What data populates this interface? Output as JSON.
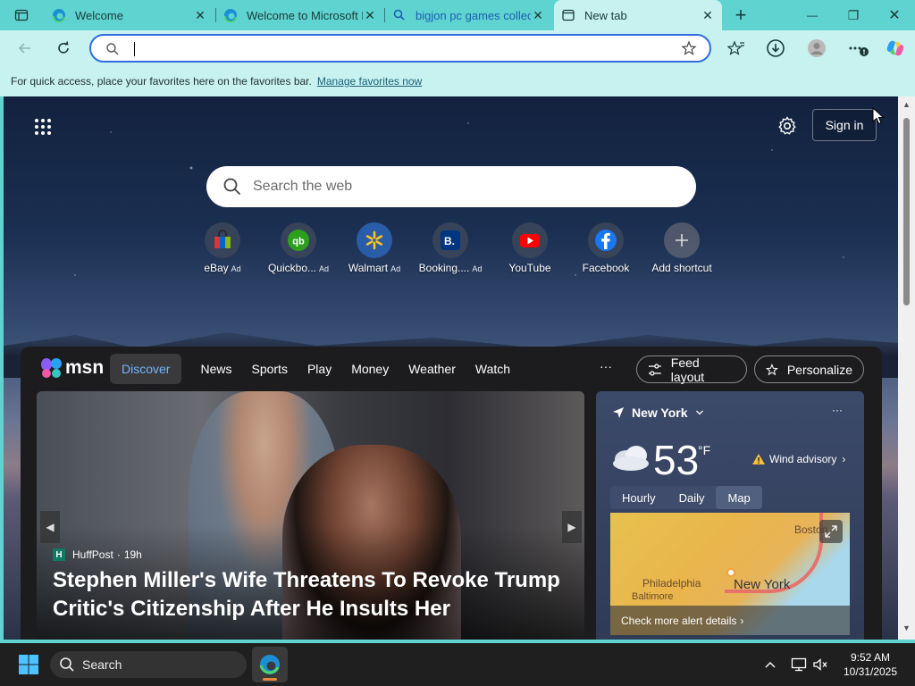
{
  "tabs": [
    {
      "title": "Welcome",
      "active": false
    },
    {
      "title": "Welcome to Microsoft E",
      "active": false
    },
    {
      "title": "bigjon pc games collect",
      "active": false
    },
    {
      "title": "New tab",
      "active": true
    }
  ],
  "tab_close": "✕",
  "new_tab_symbol": "+",
  "window_controls": {
    "minimize": "—",
    "restore": "❐",
    "close": "✕"
  },
  "address_bar": {
    "value": "",
    "placeholder": ""
  },
  "favorites_bar": {
    "message": "For quick access, place your favorites here on the favorites bar.",
    "link": "Manage favorites now"
  },
  "page": {
    "sign_in": "Sign in",
    "search_placeholder": "Search the web",
    "shortcuts": [
      {
        "label": "eBay",
        "ad": "Ad"
      },
      {
        "label": "Quickbo...",
        "ad": "Ad"
      },
      {
        "label": "Walmart",
        "ad": "Ad"
      },
      {
        "label": "Booking....",
        "ad": "Ad"
      },
      {
        "label": "YouTube",
        "ad": ""
      },
      {
        "label": "Facebook",
        "ad": ""
      },
      {
        "label": "Add shortcut",
        "ad": ""
      }
    ]
  },
  "msn": {
    "logo": "msn",
    "nav": [
      "Discover",
      "News",
      "Sports",
      "Play",
      "Money",
      "Weather",
      "Watch"
    ],
    "more": "···",
    "feed_layout": "Feed layout",
    "personalize": "Personalize",
    "hero": {
      "source": "HuffPost",
      "source_badge": "H",
      "age": "19h",
      "headline": "Stephen Miller's Wife Threatens To Revoke Trump Critic's Citizenship After He Insults Her"
    },
    "weather": {
      "location": "New York",
      "temperature": "53",
      "unit": "°F",
      "alert": "Wind advisory",
      "tabs": [
        "Hourly",
        "Daily",
        "Map"
      ],
      "active_tab": "Map",
      "map_labels": {
        "boston": "Boston",
        "philadelphia": "Philadelphia",
        "baltimore": "Baltimore",
        "new_york": "New York"
      },
      "more_link": "Check more alert details"
    }
  },
  "taskbar": {
    "search_label": "Search",
    "time": "9:52 AM",
    "date": "10/31/2025"
  }
}
